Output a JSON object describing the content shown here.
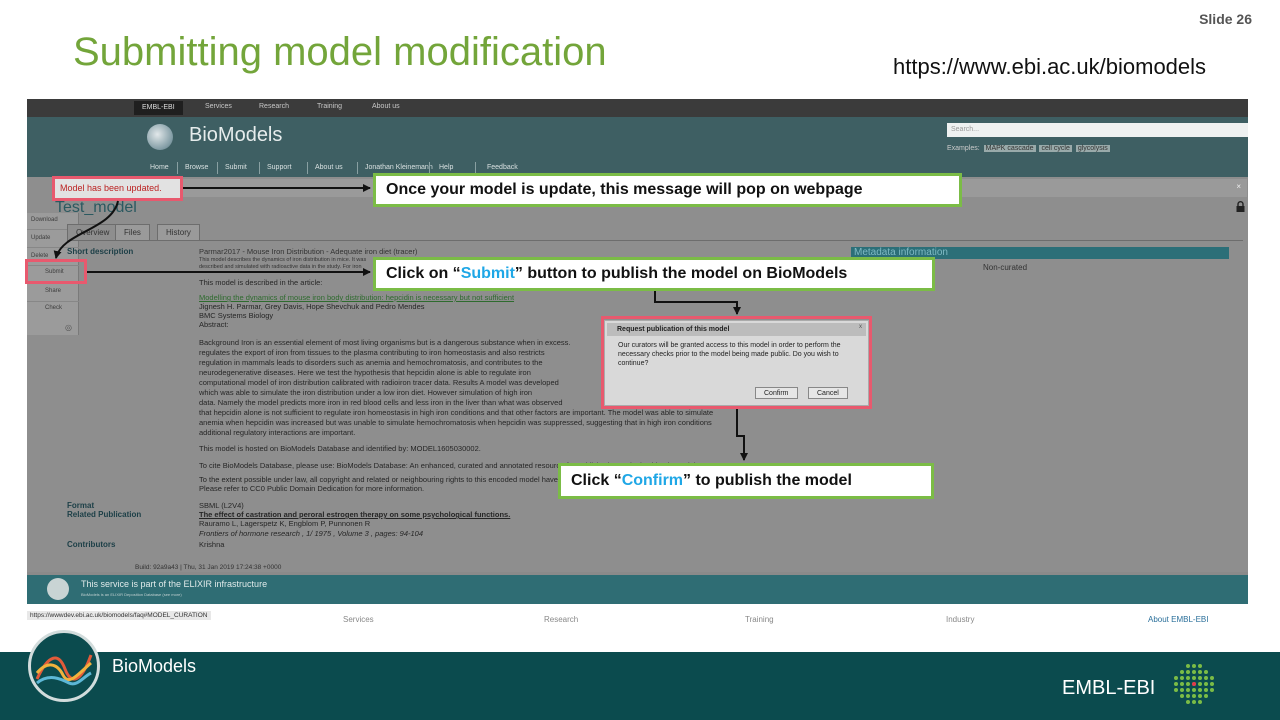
{
  "slide": {
    "number": "Slide 26",
    "title": "Submitting model modification",
    "url": "https://www.ebi.ac.uk/biomodels"
  },
  "ebi_bar": {
    "items": [
      "EMBL-EBI",
      "Services",
      "Research",
      "Training",
      "About us"
    ]
  },
  "header": {
    "site_name": "BioModels",
    "search_placeholder": "Search...",
    "examples_label": "Examples:",
    "examples": [
      "MAPK cascade",
      "cell cycle",
      "glycolysis"
    ]
  },
  "nav": {
    "items": [
      "Home",
      "Browse",
      "Submit",
      "Support",
      "About us",
      "Jonathan Kleinemann",
      "Help",
      "Feedback"
    ]
  },
  "alert": {
    "message": "Model has been updated.",
    "close": "×"
  },
  "model": {
    "title": "Test_model",
    "tabs": [
      "Overview",
      "Files",
      "History"
    ],
    "sidebar": [
      "Download",
      "Update",
      "Delete",
      "Submit",
      "Share",
      "Check"
    ],
    "short_description_label": "Short description",
    "short_description": "Parmar2017 - Mouse Iron Distribution - Adequate iron diet (tracer)",
    "short_description_detail": "This model describes the dynamics of iron distribution in mice. It was described and simulated with radioactive data in the study. For iron diet.",
    "described_in": "This model is described in the article:",
    "article_title": "Modelling the dynamics of mouse iron body distribution: hepcidin is necessary but not sufficient",
    "authors": "Jignesh H. Parmar, Grey Davis, Hope Shevchuk and Pedro Mendes",
    "journal": "BMC Systems Biology",
    "abstract_label": "Abstract:",
    "abstract_lines": [
      "Background Iron is an essential element of most living organisms but is a dangerous substance when in excess.",
      "regulates the export of iron from tissues to the plasma contributing to iron homeostasis and also restricts",
      "regulation in mammals leads to disorders such as anemia and hemochromatosis, and contributes to the",
      "neurodegenerative diseases. Here we test the hypothesis that hepcidin alone is able to regulate iron",
      "computational model of iron distribution calibrated with radioiron tracer data. Results A model was developed",
      "which was able to simulate the iron distribution under a low iron diet. However simulation of high iron",
      "data. Namely the model predicts more iron in red blood cells and less iron in the liver than what was observed",
      "that hepcidin alone is not sufficient to regulate iron homeostasis in high iron conditions and that other factors are important. The model was able to simulate",
      "anemia when hepcidin was increased but was unable to simulate hemochromatosis when hepcidin was suppressed, suggesting that in high iron conditions",
      "additional regulatory interactions are important."
    ],
    "hosted_line": "This model is hosted on BioModels Database and identified by: MODEL1605030002.",
    "cite_line": "To cite BioModels Database, please use: BioModels Database: An enhanced, curated and annotated resource for published quantitative kinetic models.",
    "rights_line_1": "To the extent possible under law, all copyright and related or neighbouring rights to this encoded model have been dedicated to the public domain worldwide.",
    "rights_line_2": "Please refer to CC0 Public Domain Dedication for more information.",
    "format_label": "Format",
    "format_value": "SBML (L2V4)",
    "related_label": "Related Publication",
    "related_title": "The effect of castration and peroral estrogen therapy on some psychological functions.",
    "related_authors": "Rauramo L, Lagerspetz K, Engblom P, Punnonen R",
    "related_journal": "Frontiers of hormone research , 1/ 1975 , Volume 3 , pages: 94-104",
    "contributors_label": "Contributors",
    "contributors_value": "Krishna",
    "metadata_header": "Metadata information",
    "curation_status": "Non-curated"
  },
  "dialog": {
    "title": "Request publication of this model",
    "close": "x",
    "text": "Our curators will be granted access to this model in order to perform the necessary checks prior to the model being made public. Do you wish to continue?",
    "confirm": "Confirm",
    "cancel": "Cancel"
  },
  "footer": {
    "build": "Build: 92a9a43 | Thu, 31 Jan 2019 17:24:38 +0000",
    "elixir": "This service is part of the ELIXIR infrastructure",
    "elixir_sub": "BioModels is an ELIXIR Deposition Database (see more)",
    "links": [
      "Services",
      "Research",
      "Training",
      "Industry",
      "About EMBL-EBI"
    ],
    "status_url": "https://wwwdev.ebi.ac.uk/biomodels/faq#MODEL_CURATION"
  },
  "callouts": {
    "update_msg": "Once your model is update, this message will pop on webpage",
    "submit_pre": "Click on “",
    "submit_hl": "Submit",
    "submit_post": "” button to publish the model on BioModels",
    "confirm_pre": "Click “",
    "confirm_hl": "Confirm",
    "confirm_post": "” to publish the model"
  },
  "branding": {
    "product": "BioModels",
    "institute": "EMBL-EBI"
  },
  "colors": {
    "title_green": "#73a53a",
    "callout_border": "#7bbc46",
    "highlight_blue": "#1fa7e6",
    "red_box": "#e8596e",
    "bottom_band": "#0b4b4e"
  }
}
